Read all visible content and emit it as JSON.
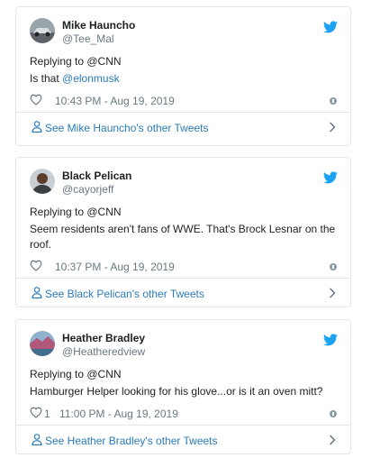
{
  "tweets": [
    {
      "name": "Mike Hauncho",
      "handle": "@Tee_Mal",
      "replying_to": "Replying to @CNN",
      "text_prefix": "Is that ",
      "mention": "@elonmusk",
      "likes": "",
      "time": "10:43 PM - Aug 19, 2019",
      "footer": "See Mike Hauncho's other Tweets",
      "avatar_icon": "avatar-photo-car"
    },
    {
      "name": "Black Pelican",
      "handle": "@cayorjeff",
      "replying_to": "Replying to @CNN",
      "text_prefix": "Seem residents aren't fans of WWE. That's Brock Lesnar on the roof.",
      "mention": "",
      "likes": "",
      "time": "10:37 PM - Aug 19, 2019",
      "footer": "See Black Pelican's other Tweets",
      "avatar_icon": "avatar-photo-person"
    },
    {
      "name": "Heather Bradley",
      "handle": "@Heatheredview",
      "replying_to": "Replying to @CNN",
      "text_prefix": "Hamburger Helper looking for his glove...or is it an oven mitt?",
      "mention": "",
      "likes": "1",
      "time": "11:00 PM - Aug 19, 2019",
      "footer": "See Heather Bradley's other Tweets",
      "avatar_icon": "avatar-photo-landscape"
    }
  ],
  "colors": {
    "link": "#2b7bb9",
    "twitter_blue": "#1da1f2",
    "muted": "#697882",
    "border": "#e1e8ed"
  }
}
